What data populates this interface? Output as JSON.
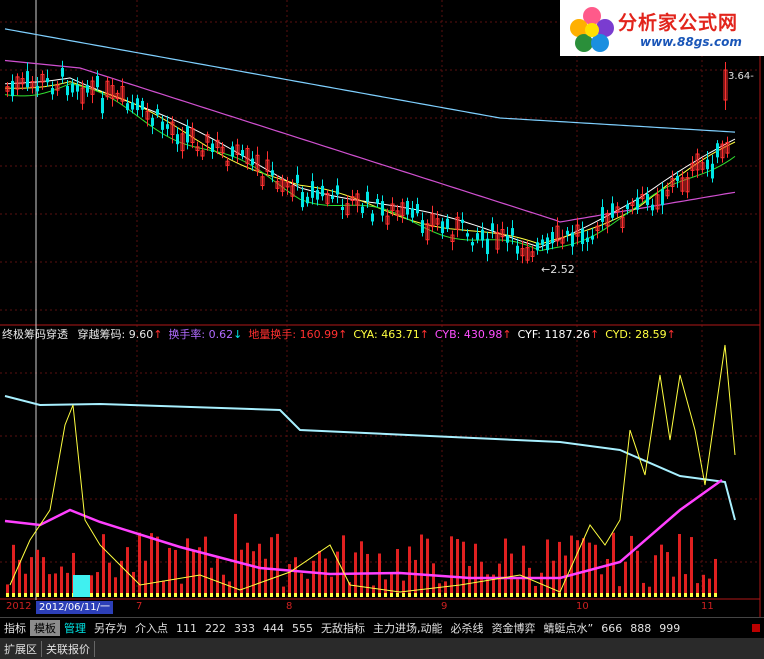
{
  "logo": {
    "title": "分析家公式网",
    "url": "www.88gs.com"
  },
  "price_chart": {
    "high_label": "3.64",
    "low_label": "2.52"
  },
  "indicator": {
    "name": "终极筹码穿透",
    "fields": [
      {
        "label": "穿越筹码:",
        "value": "9.60",
        "arrow": "↑",
        "color": "#e8e8e8"
      },
      {
        "label": "换手率:",
        "value": "0.62",
        "arrow": "↓",
        "color": "#b06cff"
      },
      {
        "label": "地量换手:",
        "value": "160.99",
        "arrow": "↑",
        "color": "#ff3030"
      },
      {
        "label": "CYA:",
        "value": "463.71",
        "arrow": "↑",
        "color": "#ffff40"
      },
      {
        "label": "CYB:",
        "value": "430.98",
        "arrow": "↑",
        "color": "#ff50ff"
      },
      {
        "label": "CYF:",
        "value": "1187.26",
        "arrow": "↑",
        "color": "#ffffff"
      },
      {
        "label": "CYD:",
        "value": "28.59",
        "arrow": "↑",
        "color": "#ffff40"
      }
    ]
  },
  "date_axis": {
    "year": "2012",
    "selected_date": "2012/06/11/一",
    "months": [
      "7",
      "8",
      "9",
      "10",
      "11"
    ]
  },
  "toolbar": {
    "items": [
      "指标",
      "模板",
      "管理",
      "另存为",
      "介入点",
      "111",
      "222",
      "333",
      "444",
      "555",
      "无敌指标",
      "主力进场,动能",
      "必杀线",
      "资金博弈",
      "蜻蜓点水”",
      "666",
      "888",
      "999"
    ]
  },
  "bottombar": {
    "items": [
      "扩展区",
      "关联报价"
    ]
  },
  "colors": {
    "background": "#000000",
    "up_candle": "#ff3030",
    "down_candle": "#00e6e6",
    "ma_cyan": "#7fd0ff",
    "ma_magenta": "#d050d0",
    "ma_white": "#ffffff",
    "ma_yellow": "#ffff40",
    "ma_green": "#30e030"
  }
}
